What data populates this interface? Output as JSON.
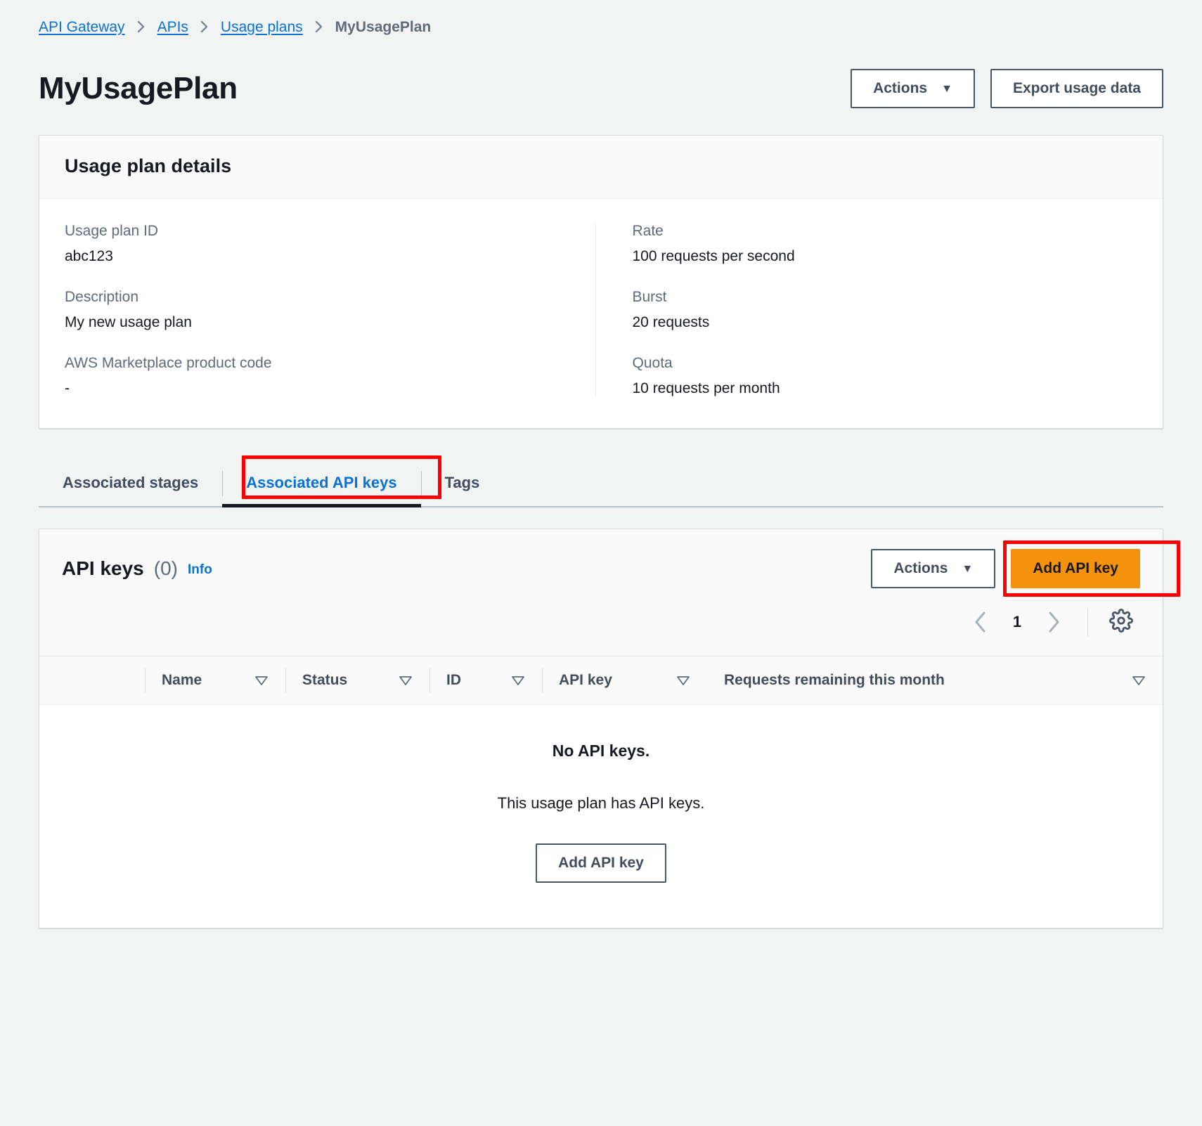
{
  "breadcrumb": {
    "items": [
      {
        "label": "API Gateway",
        "type": "link"
      },
      {
        "label": "APIs",
        "type": "link"
      },
      {
        "label": "Usage plans",
        "type": "link"
      },
      {
        "label": "MyUsagePlan",
        "type": "current"
      }
    ]
  },
  "header": {
    "title": "MyUsagePlan",
    "actions_label": "Actions",
    "actions_caret": "▼",
    "export_label": "Export usage data"
  },
  "details": {
    "card_title": "Usage plan details",
    "left": [
      {
        "label": "Usage plan ID",
        "value": "abc123"
      },
      {
        "label": "Description",
        "value": "My new usage plan"
      },
      {
        "label": "AWS Marketplace product code",
        "value": "-"
      }
    ],
    "right": [
      {
        "label": "Rate",
        "value": "100 requests per second"
      },
      {
        "label": "Burst",
        "value": "20 requests"
      },
      {
        "label": "Quota",
        "value": "10 requests per month"
      }
    ]
  },
  "tabs": [
    {
      "label": "Associated stages",
      "active": false
    },
    {
      "label": "Associated API keys",
      "active": true
    },
    {
      "label": "Tags",
      "active": false
    }
  ],
  "keys_panel": {
    "title": "API keys",
    "count": "(0)",
    "info_label": "Info",
    "actions_label": "Actions",
    "actions_caret": "▼",
    "add_key_label": "Add API key",
    "pagination": {
      "prev_icon": "chevron-left-icon",
      "page": "1",
      "next_icon": "chevron-right-icon",
      "settings_icon": "gear-icon"
    },
    "columns": [
      {
        "label": "Name",
        "sort_icon": "sort-triangle-icon"
      },
      {
        "label": "Status",
        "sort_icon": "sort-triangle-icon"
      },
      {
        "label": "ID",
        "sort_icon": "sort-triangle-icon"
      },
      {
        "label": "API key",
        "sort_icon": "sort-triangle-icon"
      },
      {
        "label": "Requests remaining this month",
        "sort_icon": "sort-triangle-icon"
      }
    ],
    "empty_state": {
      "title": "No API keys.",
      "subtitle": "This usage plan has API keys.",
      "button_label": "Add API key"
    }
  },
  "colors": {
    "link": "#0972d3",
    "primary_button": "#f5920b",
    "annotation": "#ff0000",
    "page_bg": "#f2f3f3",
    "text": "#16191f",
    "muted_text": "#5f6b7a"
  }
}
